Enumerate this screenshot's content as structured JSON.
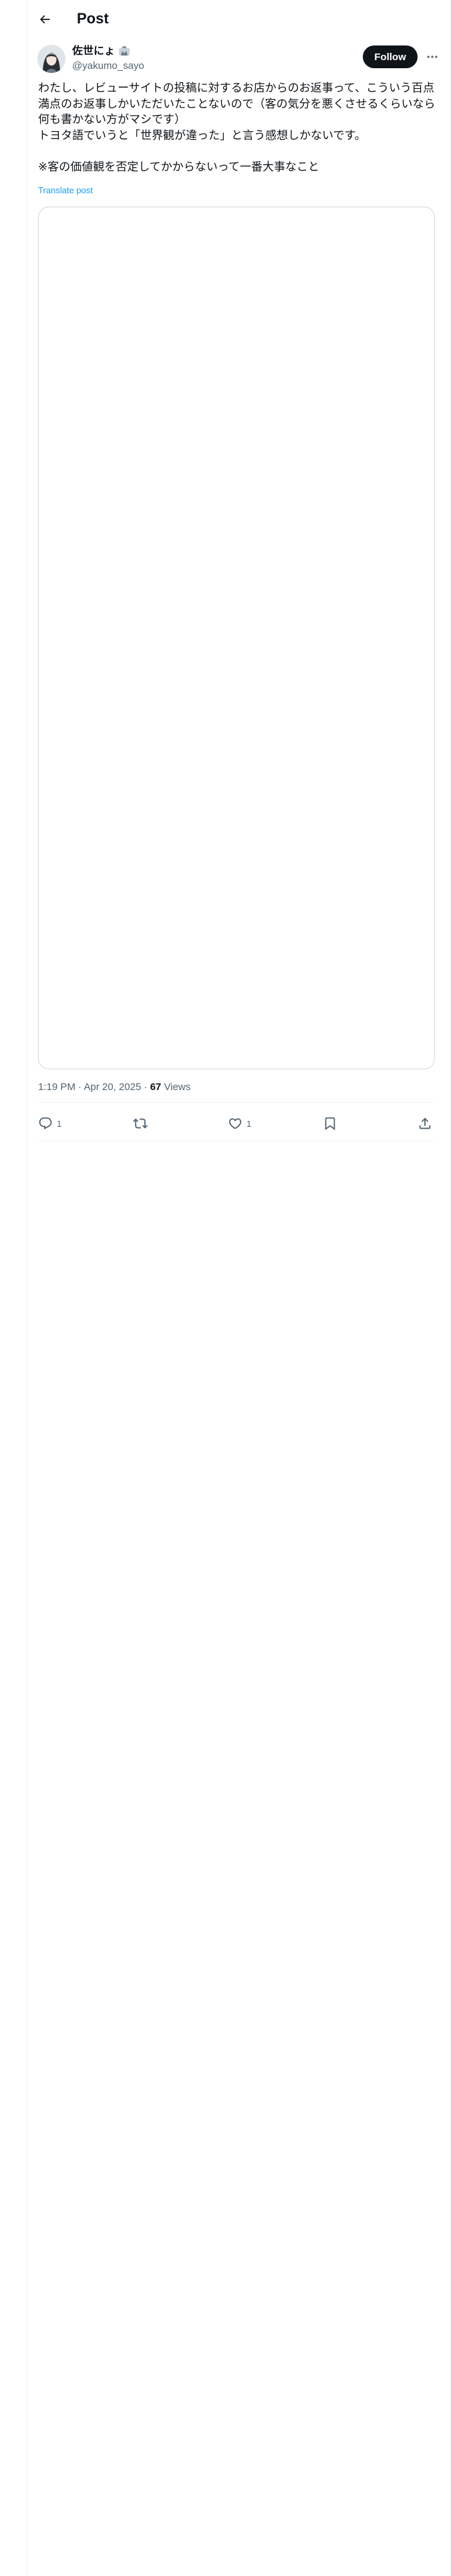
{
  "header": {
    "title": "Post"
  },
  "author": {
    "name": "佐世にょ",
    "handle": "@yakumo_sayo"
  },
  "follow_label": "Follow",
  "post": {
    "lines": [
      "わたし、レビューサイトの投稿に対するお店からのお返事って、こういう百点満点のお返事しかいただいたことないので（客の気分を悪くさせるくらいなら何も書かない方がマシです）",
      "トヨタ語でいうと「世界観が違った」と言う感想しかないです。",
      "",
      "※客の価値観を否定してかからないって一番大事なこと"
    ],
    "translate_label": "Translate post"
  },
  "meta": {
    "time": "1:19 PM · Apr 20, 2025 · ",
    "views": "67",
    "views_label": " Views"
  },
  "actions": {
    "replies": "1",
    "likes": "1"
  },
  "icons": [
    "back-arrow-icon",
    "name-badge-icon",
    "more-icon",
    "reply-icon",
    "repost-icon",
    "like-icon",
    "bookmark-icon",
    "share-icon"
  ]
}
